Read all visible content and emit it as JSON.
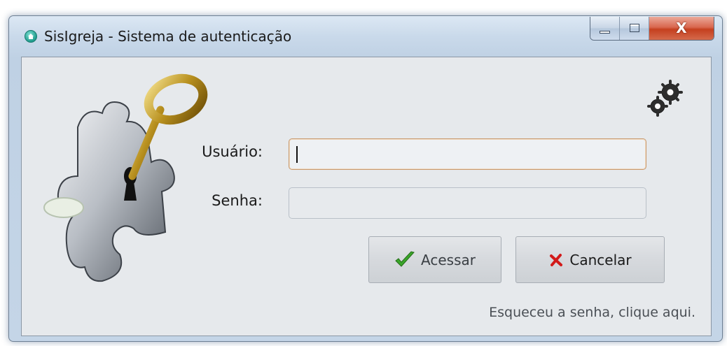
{
  "window": {
    "title": "SisIgreja - Sistema de autenticação",
    "app_icon": "home-icon",
    "controls": {
      "minimize": "minimize-icon",
      "maximize": "maximize-icon",
      "close_label": "X"
    }
  },
  "form": {
    "logo_icon": "puzzle-key-icon",
    "settings_icon": "gears-icon",
    "username_label": "Usuário:",
    "username_value": "",
    "password_label": "Senha:",
    "password_value": "",
    "access_button": {
      "label": "Acessar",
      "icon": "checkmark-icon",
      "icon_color": "#3aa62a"
    },
    "cancel_button": {
      "label": "Cancelar",
      "icon": "cross-icon",
      "icon_color": "#d21a1a"
    },
    "forgot_link": "Esqueceu a senha, clique aqui."
  },
  "colors": {
    "titlebar": "#c9d9ea",
    "client_bg": "#e6e9ec",
    "close_button": "#c5401f",
    "focus_border": "#c89a6e"
  }
}
